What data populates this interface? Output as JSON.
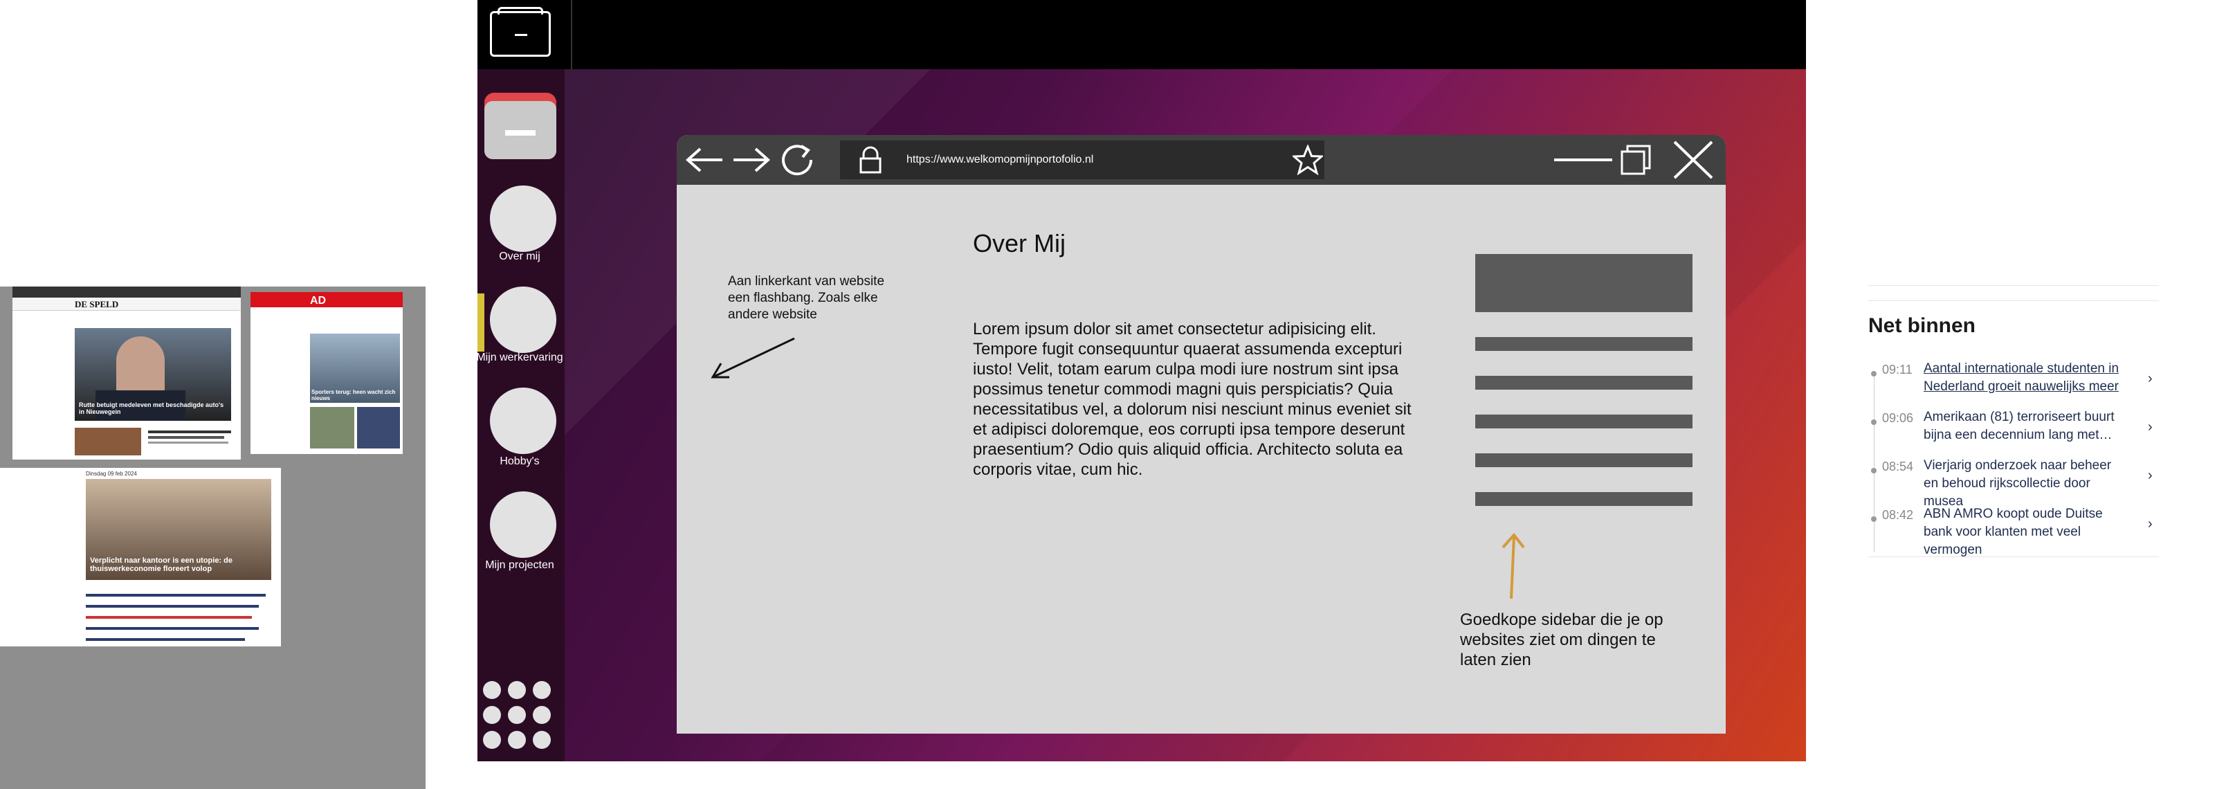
{
  "dock": {
    "items": [
      {
        "label": "Over mij"
      },
      {
        "label": "Mijn werkervaring"
      },
      {
        "label": "Hobby's"
      },
      {
        "label": "Mijn projecten"
      }
    ]
  },
  "browser": {
    "url": "https://www.welkomopmijnportofolio.nl"
  },
  "page": {
    "title": "Over Mij",
    "body": "Lorem ipsum dolor sit amet consectetur adipisicing elit. Tempore  fugit consequuntur quaerat assumenda excepturi iusto! Velit, totam earum  culpa modi iure nostrum sint ipsa possimus tenetur commodi magni quis perspiciatis?     Quia necessitatibus vel, a dolorum nisi nesciunt minus eveniet sit  et adipisci doloremque, eos corrupti ipsa tempore deserunt praesentium?  Odio quis aliquid officia. Architecto soluta ea corporis vitae, cum hic.",
    "note_left": "Aan linkerkant van website een flashbang. Zoals elke andere website",
    "note_right": "Goedkope sidebar die je op websites ziet om dingen te laten zien"
  },
  "news": {
    "title": "Net binnen",
    "items": [
      {
        "time": "09:11",
        "text": "Aantal internationale studenten in Nederland groeit nauwelijks meer"
      },
      {
        "time": "09:06",
        "text": "Amerikaan (81) terroriseert buurt bijna een decennium lang met…"
      },
      {
        "time": "08:54",
        "text": "Vierjarig onderzoek naar beheer en behoud rijkscollectie door musea"
      },
      {
        "time": "08:42",
        "text": "ABN AMRO koopt oude Duitse bank voor klanten met veel vermogen"
      }
    ]
  },
  "thumbnails": {
    "speld": {
      "logo": "DE SPELD",
      "headline": "Rutte betuigt medeleven met beschadigde auto's in Nieuwegein"
    },
    "ad": {
      "logo": "AD",
      "headline": "Sporters terug: heen wacht zich nieuws"
    },
    "article": {
      "date": "Dinsdag 09 feb 2024",
      "headline": "Verplicht naar kantoor is een utopie: de thuiswerkeconomie floreert volop"
    }
  },
  "colors": {
    "accent_arrow": "#d39a3c",
    "dock_indicator": "#d8c23a"
  }
}
